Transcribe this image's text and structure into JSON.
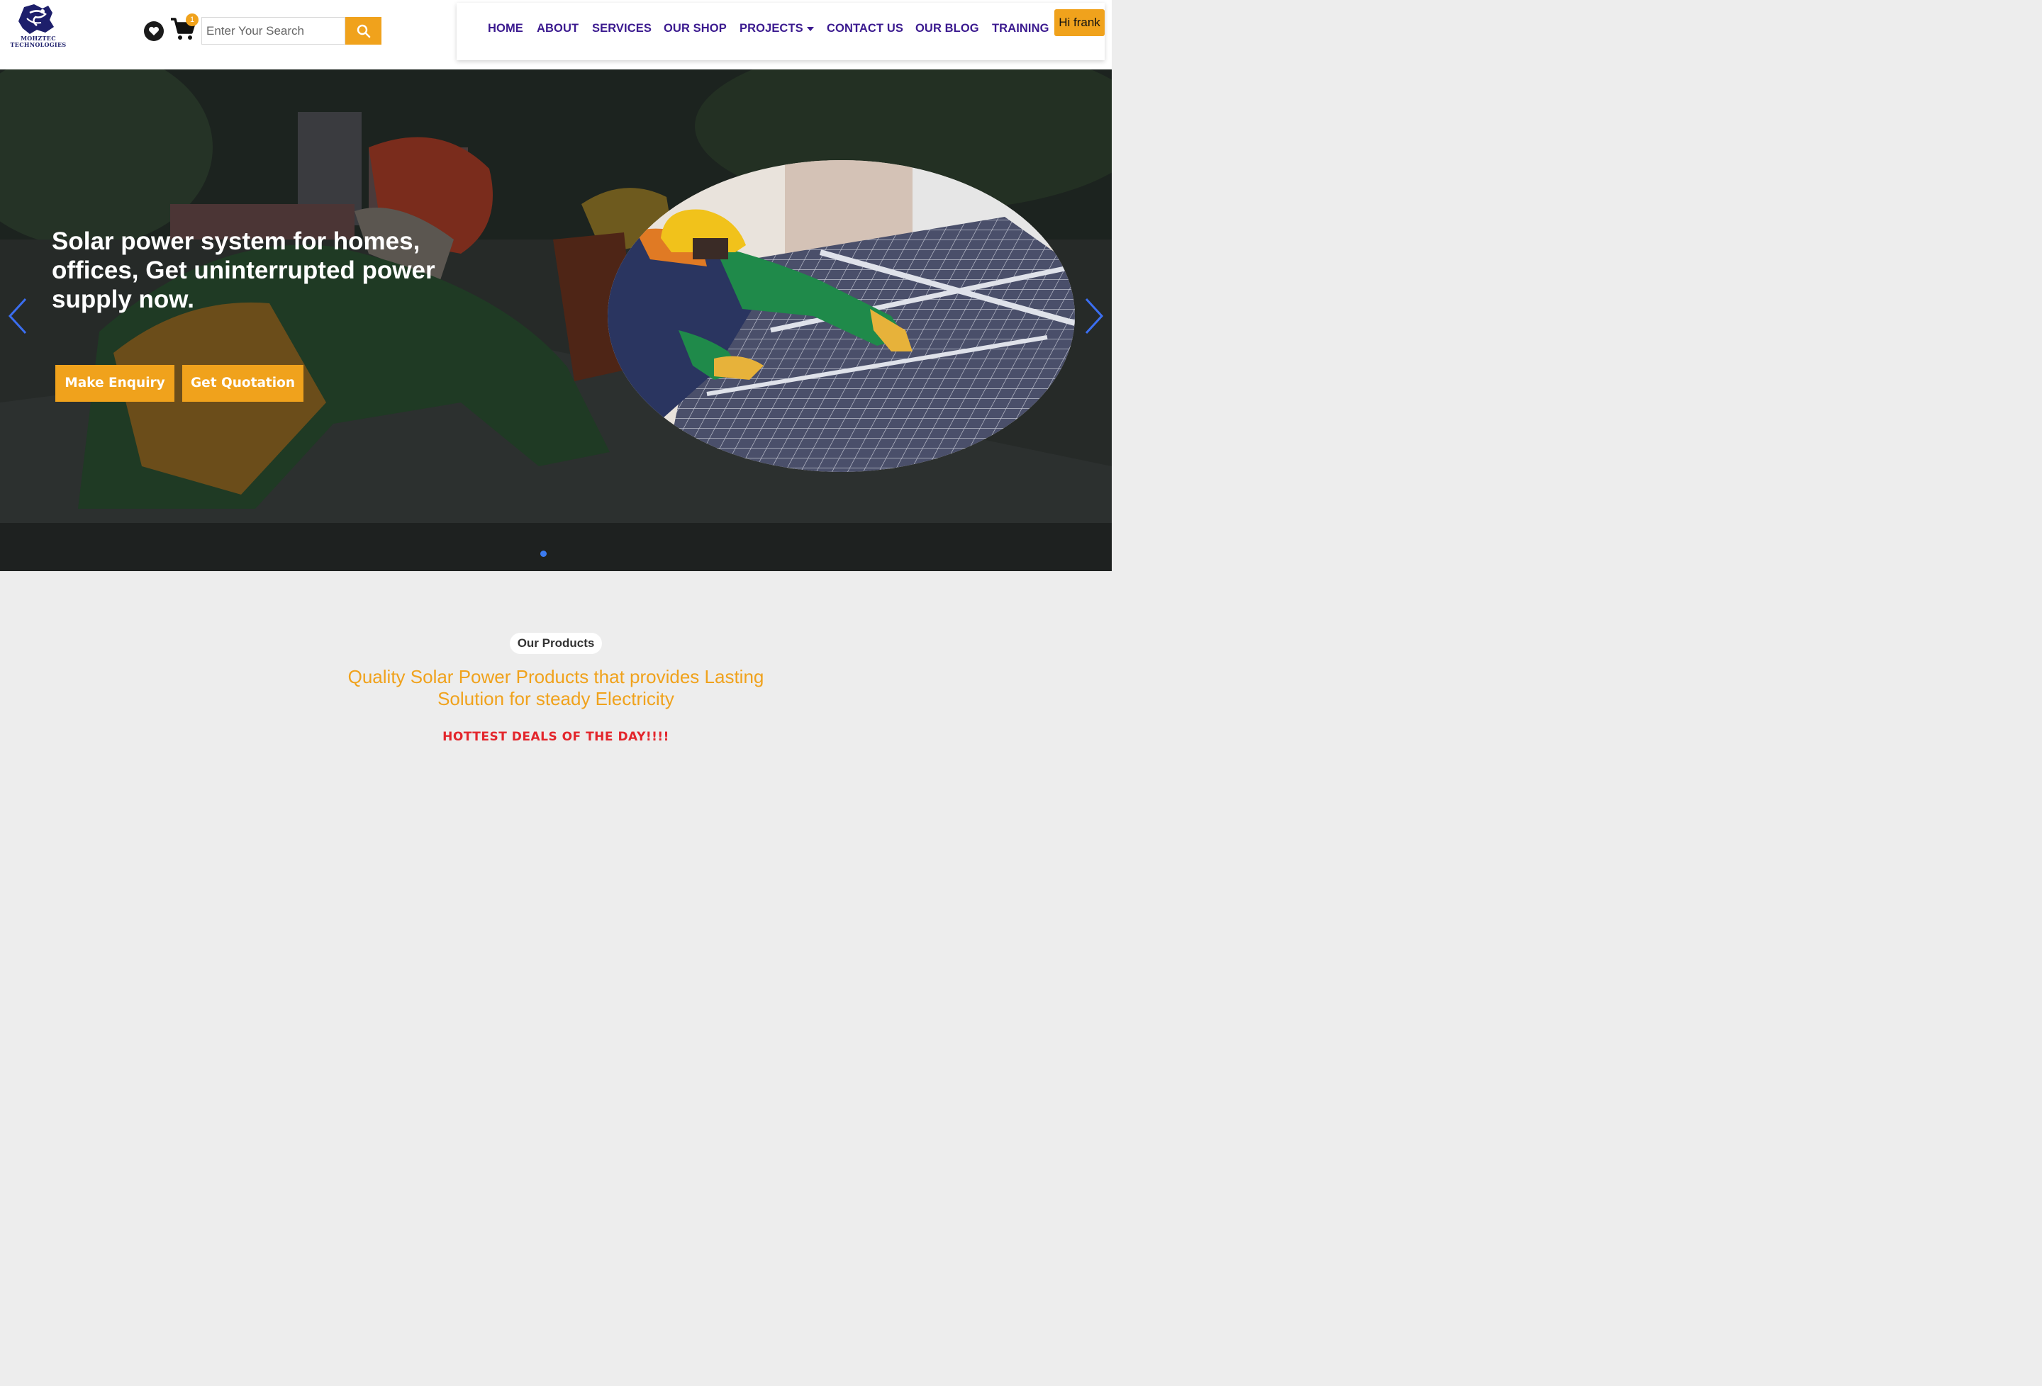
{
  "header": {
    "logo_text_line1": "MOHZTEC",
    "logo_text_line2": "TECHNOLOGIES",
    "wishlist_icon": "heart-icon",
    "cart_icon": "cart-icon",
    "cart_count": "1",
    "search_placeholder": "Enter Your Search",
    "search_icon": "search-icon"
  },
  "nav": {
    "items": [
      {
        "label": "HOME"
      },
      {
        "label": "ABOUT"
      },
      {
        "label": "SERVICES"
      },
      {
        "label": "OUR SHOP"
      },
      {
        "label": "PROJECTS"
      },
      {
        "label": "CONTACT US"
      },
      {
        "label": "OUR BLOG"
      },
      {
        "label": "TRAINING"
      }
    ],
    "user_label": "Hi frank"
  },
  "hero": {
    "title": "Solar power system for homes, offices, Get uninterrupted power supply now.",
    "enquiry_label": "Make Enquiry",
    "quotation_label": "Get Quotation",
    "prev_icon": "chevron-left-icon",
    "next_icon": "chevron-right-icon"
  },
  "products": {
    "pill_label": "Our Products",
    "subtitle": "Quality Solar Power Products that provides Lasting Solution for steady Electricity",
    "deals_label": "HOTTEST DEALS OF THE DAY!!!!"
  },
  "colors": {
    "accent": "#f0a21c",
    "nav_text": "#3b1a8f",
    "deals_red": "#e3262c",
    "carousel_blue": "#3b7bf0"
  }
}
